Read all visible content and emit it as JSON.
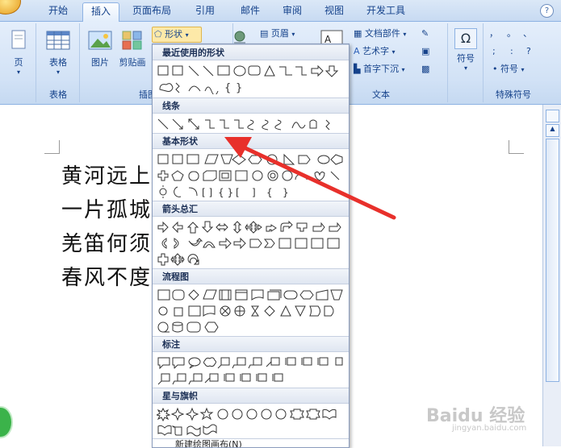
{
  "tabs": [
    "开始",
    "插入",
    "页面布局",
    "引用",
    "邮件",
    "审阅",
    "视图",
    "开发工具"
  ],
  "active_tab": "插入",
  "help_glyph": "?",
  "ribbon": {
    "page_btn": "页",
    "table_btn": "表格",
    "table_group": "表格",
    "picture_btn": "图片",
    "clipart_btn": "剪贴画",
    "illus_group": "插图",
    "shapes_btn": "形状",
    "header_btn": "页眉",
    "docparts_btn": "文档部件",
    "wordart_btn": "艺术字",
    "dropcap_btn": "首字下沉",
    "text_group": "文本",
    "symbol_btn": "符号",
    "symbol_small": "符号",
    "special_group": "特殊符号",
    "special_chars": [
      "，",
      "。",
      "、",
      ";",
      ":",
      "?"
    ]
  },
  "document": {
    "lines": [
      "黄河远上",
      "一片孤城",
      "羌笛何须",
      "春风不度"
    ]
  },
  "dropdown": {
    "sections": [
      "最近使用的形状",
      "线条",
      "基本形状",
      "箭头总汇",
      "流程图",
      "标注",
      "星与旗帜"
    ],
    "footer": "新建绘图画布(N)"
  },
  "watermark": "Baidu 经验",
  "watermark_url": "jingyan.baidu.com"
}
